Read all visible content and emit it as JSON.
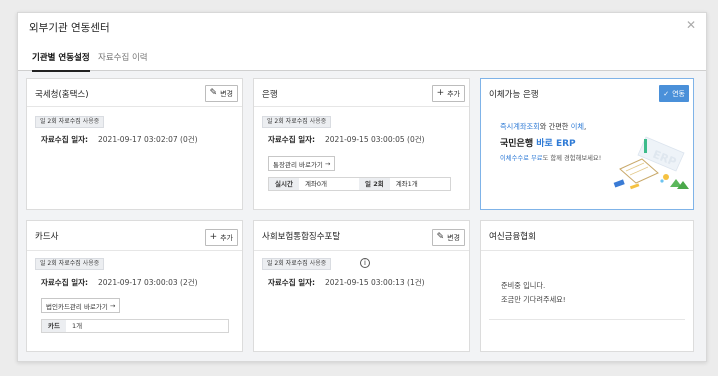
{
  "window": {
    "title": "외부기관 연동센터"
  },
  "tabs": [
    {
      "label": "기관별 연동설정",
      "active": true
    },
    {
      "label": "자료수집 이력",
      "active": false
    }
  ],
  "cards": {
    "nts": {
      "title": "국세청(홈택스)",
      "button": "변경",
      "badge_prefix": "일 2회 자료수집",
      "badge_suffix": "사용중",
      "collect_label": "자료수집 일자:",
      "collect_value": "2021-09-17 03:02:07 (0건)"
    },
    "bank": {
      "title": "은행",
      "button": "추가",
      "badge_prefix": "일 2회 자료수집",
      "badge_suffix": "사용중",
      "collect_label": "자료수집 일자:",
      "collect_value": "2021-09-15 03:00:05 (0건)",
      "link": "통장관리 바로가기",
      "stats": [
        {
          "label": "실시간",
          "value": "계좌0개"
        },
        {
          "label": "일 2회",
          "value": "계좌1개"
        }
      ]
    },
    "transfer": {
      "title": "이체가능 은행",
      "button": "연동",
      "line1_a": "즉시계좌조회",
      "line1_b": "와 간편한 ",
      "line1_c": "이체",
      "line1_d": ",",
      "line2_a": "국민은행 ",
      "line2_b": "바로 ERP",
      "line3_a": "이체수수료 무료",
      "line3_b": "도 함께 경험해보세요!",
      "accent": "#2f7bd6"
    },
    "cardco": {
      "title": "카드사",
      "button": "추가",
      "badge_prefix": "일 2회 자료수집",
      "badge_suffix": "사용중",
      "collect_label": "자료수집 일자:",
      "collect_value": "2021-09-17 03:00:03 (2건)",
      "link": "법인카드관리 바로가기",
      "stats": [
        {
          "label": "카드",
          "value": "1개"
        }
      ]
    },
    "social": {
      "title": "사회보험통합징수포탈",
      "button": "변경",
      "badge_prefix": "일 2회 자료수집",
      "badge_suffix": "사용중",
      "collect_label": "자료수집 일자:",
      "collect_value": "2021-09-15 03:00:13 (1건)"
    },
    "credit": {
      "title": "여신금융협회",
      "notice_1": "준비중 입니다.",
      "notice_2": "조금만 기다려주세요!"
    }
  }
}
